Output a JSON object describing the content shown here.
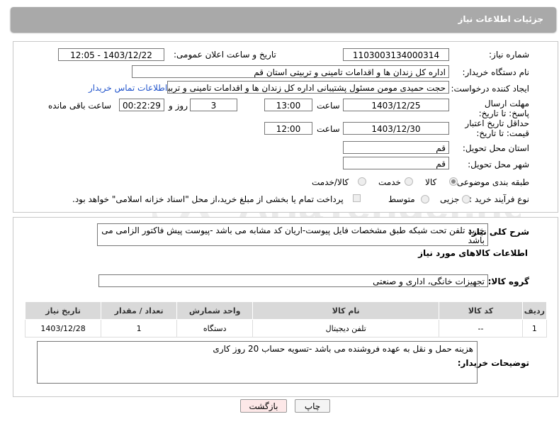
{
  "header": {
    "title": "جزئیات اطلاعات نیاز"
  },
  "form": {
    "need_number_label": "شماره نیاز:",
    "need_number": "1103003134000314",
    "announce_label": "تاریخ و ساعت اعلان عمومی:",
    "announce_value": "1403/12/22 - 12:05",
    "buyer_org_label": "نام دستگاه خریدار:",
    "buyer_org": "اداره کل زندان ها و اقدامات تامینی و تربیتی استان قم",
    "creator_label": "ایجاد کننده درخواست:",
    "creator": "حجت  حمیدی مومن مسئول پشتیبانی اداره کل زندان ها و اقدامات تامینی و تربیتی",
    "contact_link": "اطلاعات تماس خریدار",
    "reply_deadline_label": "مهلت ارسال پاسخ: تا تاریخ:",
    "reply_date": "1403/12/25",
    "time_word": "ساعت",
    "reply_time": "13:00",
    "days_value": "3",
    "days_and": "روز و",
    "remaining_time": "00:22:29",
    "remaining_label": "ساعت باقی مانده",
    "validity_label": "حداقل تاریخ اعتبار قیمت: تا تاریخ:",
    "validity_date": "1403/12/30",
    "validity_time": "12:00",
    "province_label": "استان محل تحویل:",
    "province": "قم",
    "city_label": "شهر محل تحویل:",
    "city": "قم",
    "category_label": "طبقه بندی موضوعی:",
    "category_options": [
      "کالا",
      "خدمت",
      "کالا/خدمت"
    ],
    "purchase_type_label": "نوع فرآیند خرید :",
    "purchase_options": [
      "جزیی",
      "متوسط"
    ],
    "payment_note": "پرداخت تمام یا بخشی از مبلغ خرید،از محل \"اسناد خزانه اسلامی\" خواهد بود."
  },
  "description": {
    "label": "شرح کلی نیاز:",
    "text": "خرید تلفن تحت شبکه طبق مشخصات فایل پیوست-اریان کد مشابه می باشد -پیوست پیش فاکتور الزامی می باشد"
  },
  "goods": {
    "section_title": "اطلاعات کالاهای مورد نیاز",
    "group_label": "گروه کالا:",
    "group_value": "تجهیزات خانگی، اداری و صنعتی",
    "columns": [
      "ردیف",
      "کد کالا",
      "نام کالا",
      "واحد شمارش",
      "تعداد / مقدار",
      "تاریخ نیاز"
    ],
    "rows": [
      {
        "row": "1",
        "code": "--",
        "name": "تلفن دیجیتال",
        "unit": "دستگاه",
        "qty": "1",
        "date": "1403/12/28"
      }
    ]
  },
  "buyer_notes": {
    "label": "توضیحات خریدار:",
    "text": "هزینه حمل و نقل به عهده فروشنده می باشد -تسویه حساب 20 روز کاری"
  },
  "buttons": {
    "print": "چاپ",
    "back": "بازگشت"
  },
  "watermark": {
    "text": "AriaTender.neT"
  },
  "colors": {
    "header_bg": "#a9a9a9",
    "table_header_bg": "#d9d9d9",
    "link": "#2255cc",
    "back_button_bg": "#fde8e8"
  }
}
